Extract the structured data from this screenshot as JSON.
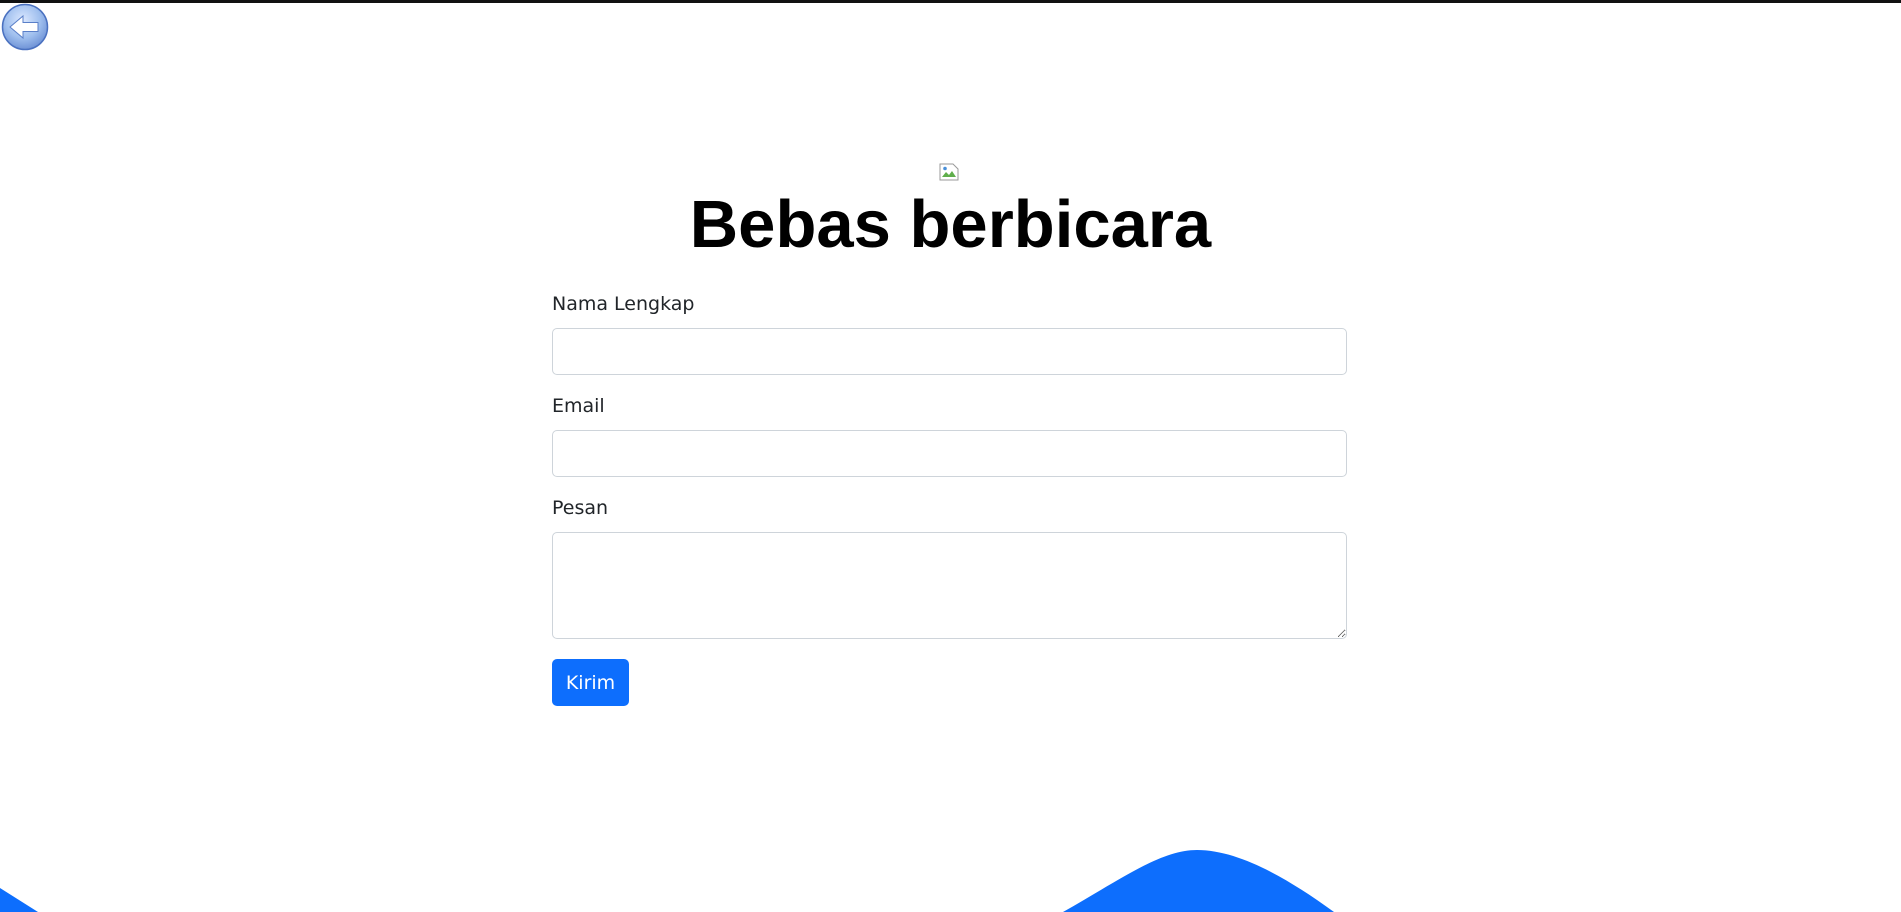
{
  "nav": {
    "back_icon": "back-arrow-icon"
  },
  "header": {
    "logo_icon": "broken-image-icon",
    "title": "Bebas berbicara"
  },
  "form": {
    "name_label": "Nama Lengkap",
    "name_value": "",
    "email_label": "Email",
    "email_value": "",
    "message_label": "Pesan",
    "message_value": "",
    "submit_label": "Kirim"
  },
  "colors": {
    "accent": "#0d6efd",
    "text": "#212529",
    "border": "#ced4da"
  }
}
